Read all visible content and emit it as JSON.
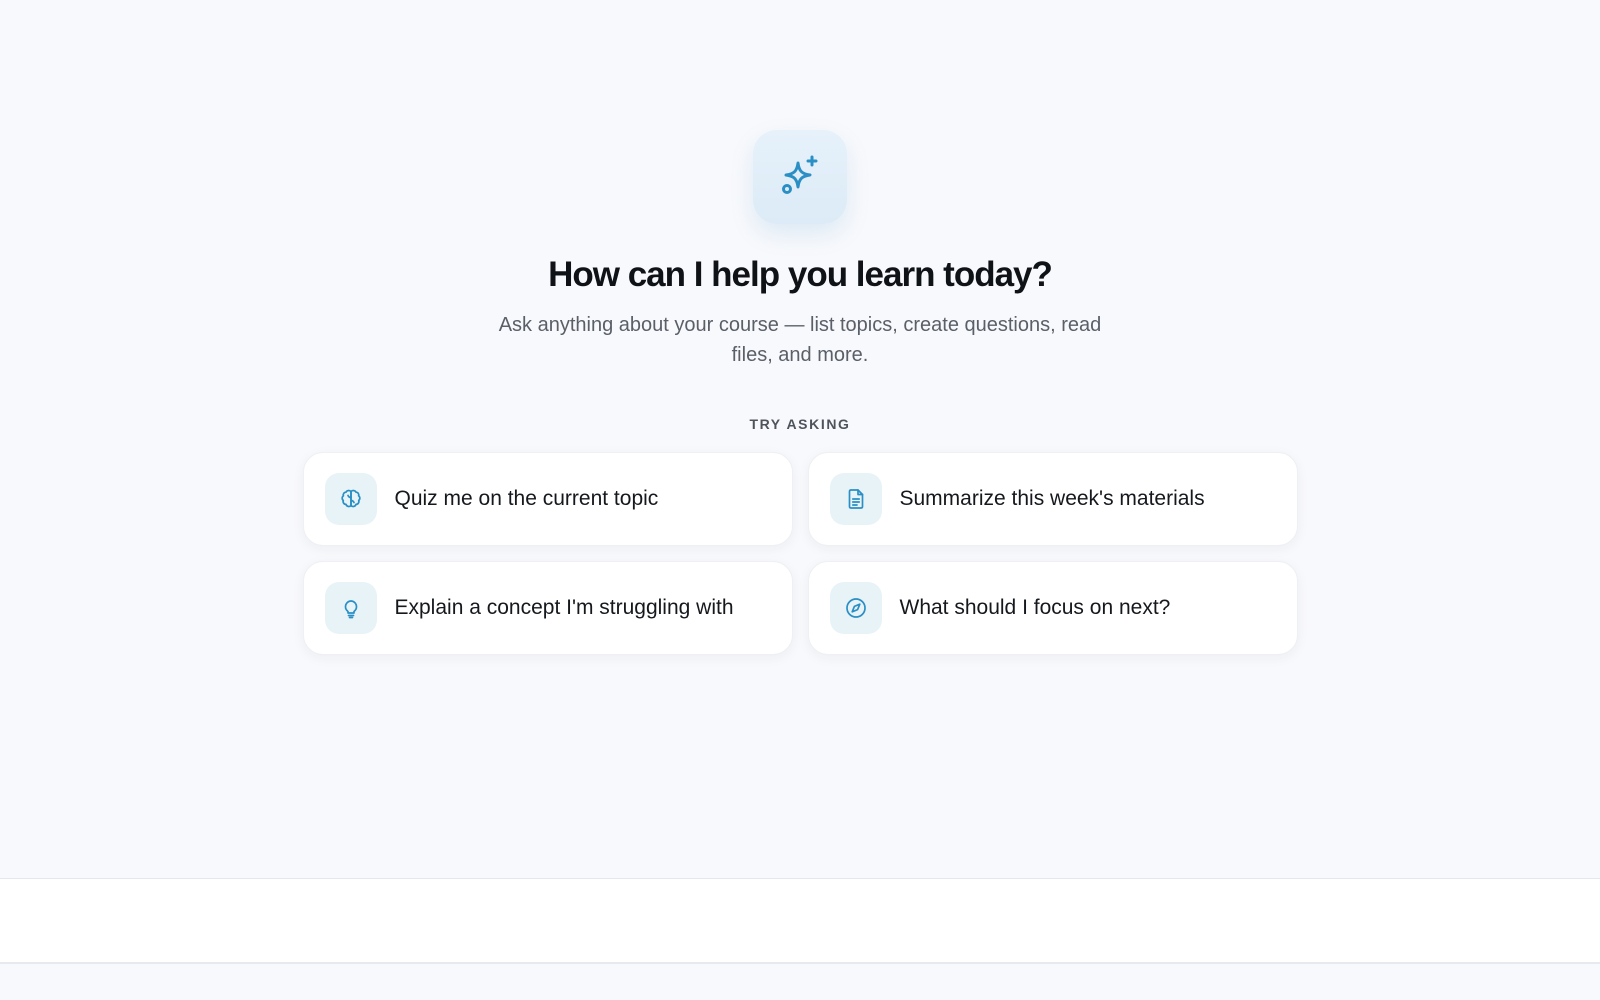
{
  "hero": {
    "icon": "sparkles-icon",
    "title": "How can I help you learn today?",
    "subtitle": "Ask anything about your course — list topics, create questions, read files, and more."
  },
  "suggestions": {
    "label": "TRY ASKING",
    "items": [
      {
        "icon": "brain-icon",
        "label": "Quiz me on the current topic"
      },
      {
        "icon": "document-icon",
        "label": "Summarize this week's materials"
      },
      {
        "icon": "lightbulb-icon",
        "label": "Explain a concept I'm struggling with"
      },
      {
        "icon": "compass-icon",
        "label": "What should I focus on next?"
      }
    ]
  },
  "colors": {
    "accent": "#2a8fc4",
    "background": "#f8f9fc",
    "card": "#ffffff",
    "icon_tile": "#e8f3f8"
  }
}
